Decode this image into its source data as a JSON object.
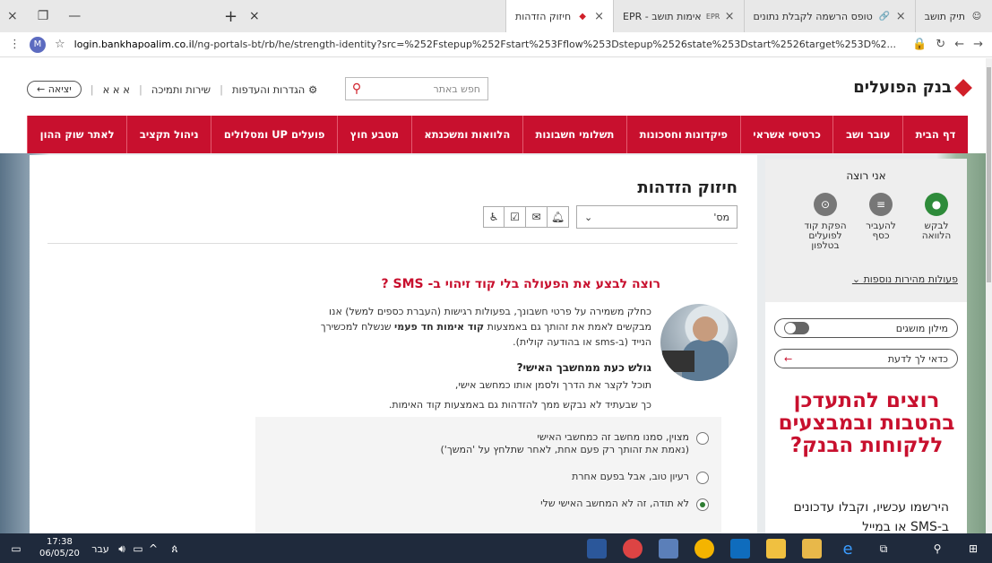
{
  "browser": {
    "tabs": [
      {
        "title": "תיק תושב",
        "favicon": "user-icon",
        "active": false
      },
      {
        "title": "טופס הרשמה לקבלת נתונים",
        "favicon": "link-icon",
        "active": false
      },
      {
        "title": "אימות תושב - EPR",
        "favicon": "epr-icon",
        "active": false
      },
      {
        "title": "חיזוק הזדהות",
        "favicon": "hapoalim-icon",
        "active": true
      }
    ],
    "url_host": "login.bankhapoalim.co.il",
    "url_rest": "/ng-portals-bt/rb/he/strength-identity?src=%252Fstepup%252Fstart%253Fflow%253Dstepup%2526state%253Dstart%2526target%253D%2...",
    "profile_initial": "M"
  },
  "header": {
    "logo_text": "בנק הפועלים",
    "search_placeholder": "חפש באתר",
    "settings_label": "הגדרות והעדפות",
    "service_label": "שירות ותמיכה",
    "font_sizes": "א א א",
    "exit_label": "יציאה"
  },
  "nav": {
    "items": [
      "דף הבית",
      "עובר ושב",
      "כרטיסי אשראי",
      "פיקדונות וחסכונות",
      "תשלומי חשבונות",
      "הלוואות ומשכנתא",
      "מטבע חוץ",
      "פועלים UP ומסלולים",
      "ניהול תקציב",
      "לאתר שוק ההון"
    ]
  },
  "main": {
    "title": "חיזוק הזדהות",
    "account_prefix": "מס'",
    "question": "רוצה לבצע את הפעולה בלי קוד זיהוי ב- SMS ?",
    "p1_a": "כחלק משמירה על פרטי חשבונך, בפעולות רגישות (העברת כספים למשל) אנו",
    "p1_b_pre": "מבקשים לאמת את זהותך גם באמצעות ",
    "p1_b_bold": "קוד אימות חד פעמי",
    "p1_b_post": " שנשלח למכשירך",
    "p1_c": "הנייד (ב-sms או בהודעה קולית).",
    "subhead": "גולש כעת ממחשבך האישי?",
    "p2_a": "תוכל לקצר את הדרך ולסמן אותו כמחשב אישי,",
    "p2_b": "כך שבעתיד לא נבקש ממך להזדהות גם באמצעות קוד האימות.",
    "options": [
      {
        "line1": "מצוין, סמנו מחשב זה כמחשבי האישי",
        "line2": "(נאמת את זהותך רק פעם אחת, לאחר שתלחץ על 'המשך')",
        "selected": false
      },
      {
        "line1": "רעיון טוב, אבל בפעם אחרת",
        "line2": "",
        "selected": false
      },
      {
        "line1": "לא תודה, זה לא המחשב האישי שלי",
        "line2": "",
        "selected": true
      }
    ]
  },
  "sidebar": {
    "want_title": "אני רוצה",
    "actions": [
      {
        "label1": "לבקש",
        "label2": "הלוואה",
        "label3": "",
        "icon": "bag-icon"
      },
      {
        "label1": "להעביר",
        "label2": "כסף",
        "label3": "",
        "icon": "transfer-icon"
      },
      {
        "label1": "הפקת קוד",
        "label2": "לפועלים",
        "label3": "בטלפון",
        "icon": "phone-code-icon"
      }
    ],
    "more_actions": "פעולות מהירות נוספות",
    "glossary": "מילון מושגים",
    "worth_knowing": "כדאי לך לדעת",
    "promo_title": "רוצים להתעדכן בהטבות ובמבצעים ללקוחות הבנק?",
    "promo_text": "הירשמו עכשיו, וקבלו עדכונים ב-SMS או במייל"
  },
  "taskbar": {
    "time": "17:38",
    "date": "06/05/20",
    "lang": "עבר"
  },
  "colors": {
    "brand_red": "#c8102e",
    "green": "#2e8b3a"
  }
}
